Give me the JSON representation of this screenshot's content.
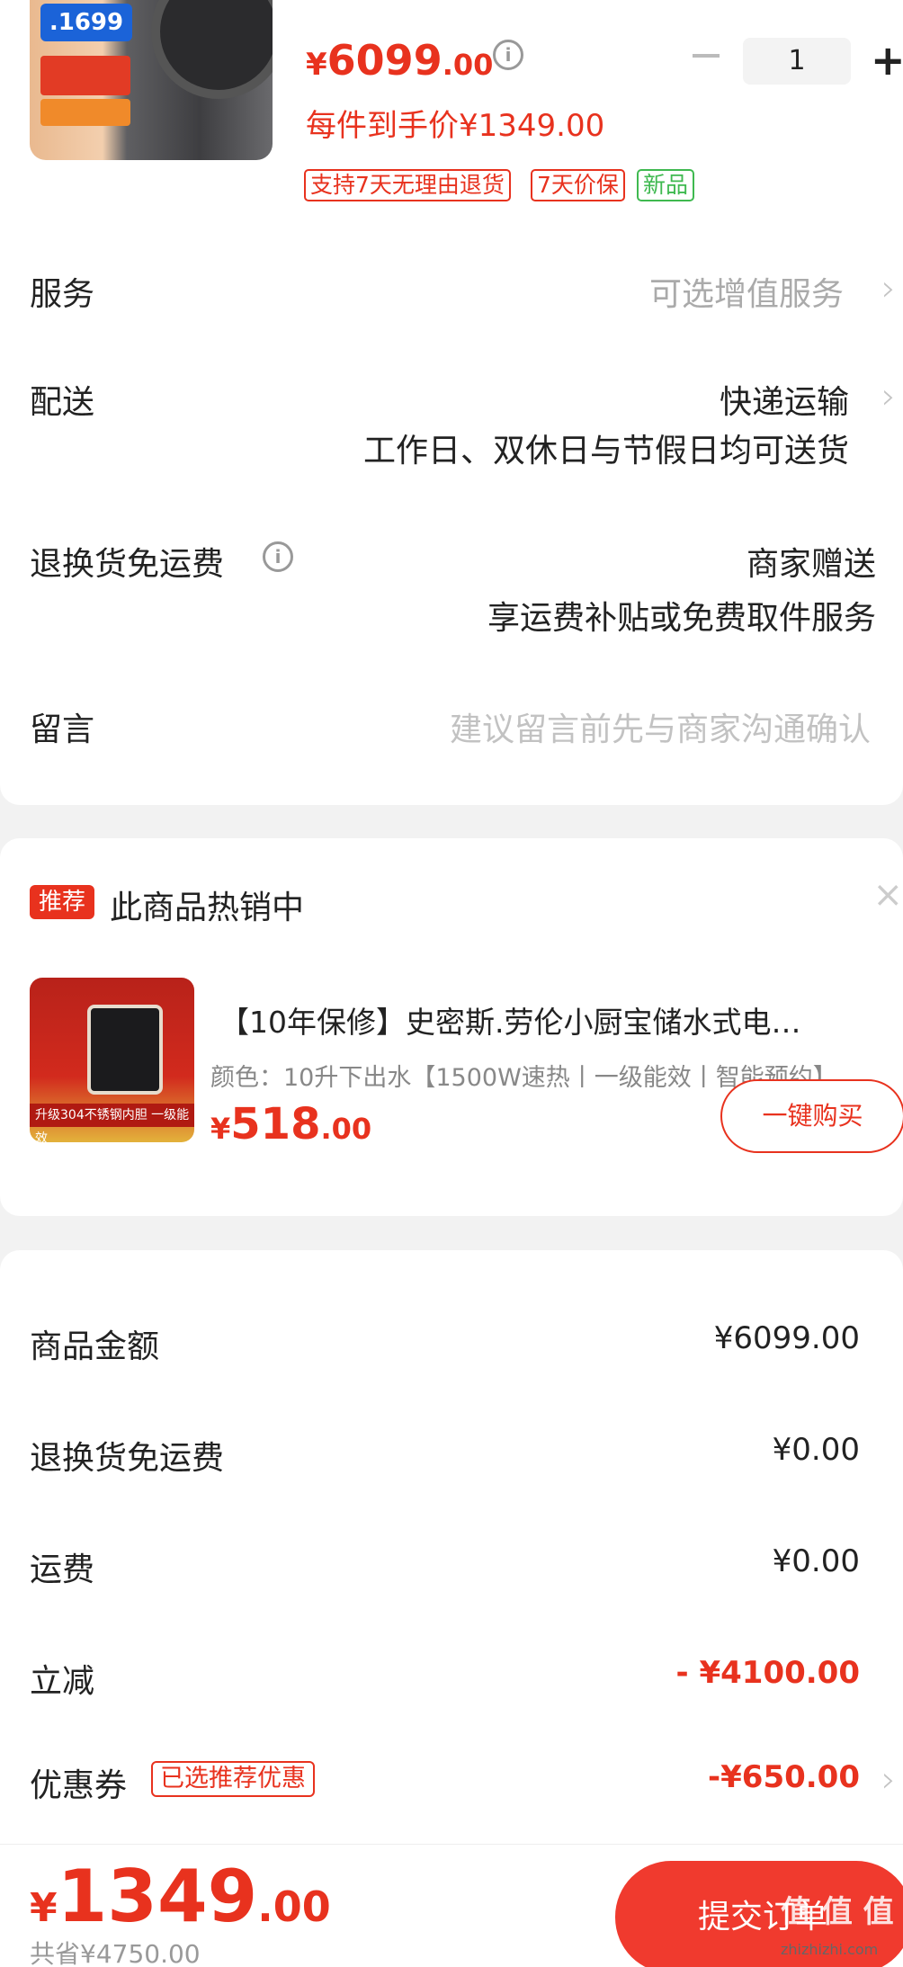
{
  "product": {
    "badge_price": ".1699",
    "price_yen": "¥",
    "price_int": "6099",
    "price_dec": ".00",
    "quantity": "1",
    "each_price": "每件到手价¥1349.00",
    "tags": [
      "支持7天无理由退货",
      "7天价保",
      "新品"
    ]
  },
  "rows": {
    "service_label": "服务",
    "service_value": "可选增值服务",
    "delivery_label": "配送",
    "delivery_value": "快递运输",
    "delivery_sub": "工作日、双休日与节假日均可送货",
    "return_label": "退换货免运费",
    "return_value": "商家赠送",
    "return_sub": "享运费补贴或免费取件服务",
    "note_label": "留言",
    "note_placeholder": "建议留言前先与商家沟通确认"
  },
  "recommend": {
    "badge": "推荐",
    "title": "此商品热销中",
    "name": "【10年保修】史密斯.劳伦小厨宝储水式电…",
    "spec": "颜色：10升下出水【1500W速热丨一级能效丨智能预约】",
    "price_yen": "¥",
    "price_int": "518",
    "price_dec": ".00",
    "buy_label": "一键购买",
    "thumb_strip": "升级304不锈钢内胆  一级能效"
  },
  "summary": {
    "items": [
      {
        "label": "商品金额",
        "value": "¥6099.00"
      },
      {
        "label": "退换货免运费",
        "value": "¥0.00"
      },
      {
        "label": "运费",
        "value": "¥0.00"
      },
      {
        "label": "立减",
        "value": "- ¥4100.00"
      },
      {
        "label": "优惠券",
        "value": "-¥650.00"
      }
    ],
    "coupon_tag": "已选推荐优惠"
  },
  "bottom": {
    "total_yen": "¥",
    "total_int": "1349",
    "total_dec": ".00",
    "saved": "共省¥4750.00",
    "submit_label": "提交订单",
    "watermark": "值 值 值",
    "watermark_sub": "zhizhizhi.com"
  },
  "colors": {
    "accent": "#e8321e",
    "green_tag": "#3fb950",
    "submit_bg": "#f03a2e"
  },
  "icons": [
    "info-icon",
    "minus-icon",
    "plus-icon",
    "chevron-right-icon",
    "close-icon"
  ]
}
